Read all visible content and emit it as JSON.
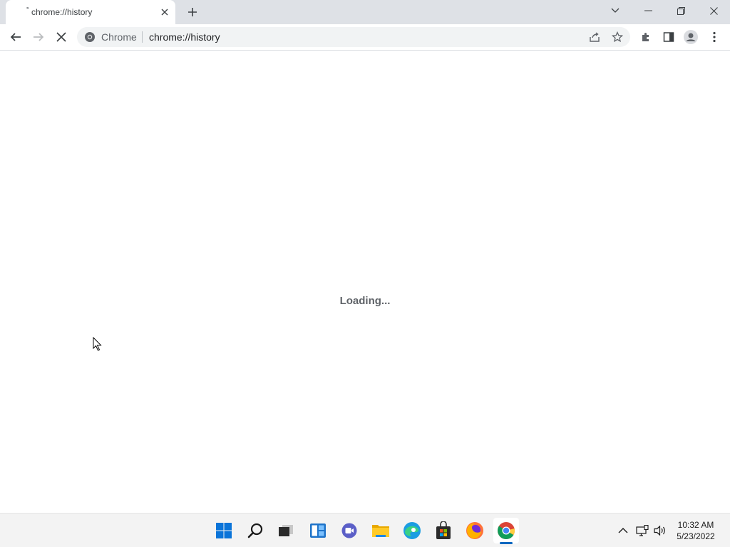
{
  "browser": {
    "tab": {
      "title": "chrome://history",
      "icon": "loading-spinner-icon",
      "close_icon": "close-icon"
    },
    "new_tab_icon": "plus-icon",
    "window_controls": [
      "chevron-down-icon",
      "minimize-icon",
      "restore-icon",
      "close-icon"
    ],
    "nav": {
      "back_icon": "arrow-left-icon",
      "forward_icon": "arrow-right-icon",
      "stop_icon": "stop-loading-icon"
    },
    "omnibox": {
      "site_chip": "Chrome",
      "url": "chrome://history",
      "site_icon": "chrome-icon",
      "share_icon": "share-icon",
      "bookmark_icon": "star-icon"
    },
    "toolbar_right": [
      "extensions-icon",
      "side-panel-icon",
      "profile-icon",
      "more-vertical-icon"
    ]
  },
  "content": {
    "loading_text": "Loading..."
  },
  "taskbar": {
    "apps": [
      "windows-start-icon",
      "search-icon",
      "task-view-icon",
      "widgets-icon",
      "teams-chat-icon",
      "file-explorer-icon",
      "edge-icon",
      "store-icon",
      "firefox-icon",
      "chrome-icon"
    ],
    "active_app": "chrome-icon",
    "tray": [
      "chevron-up-icon",
      "network-icon",
      "volume-icon"
    ],
    "clock": {
      "time": "10:32 AM",
      "date": "5/23/2022"
    }
  },
  "colors": {
    "tabstrip_bg": "#dee1e6",
    "omnibox_bg": "#f1f3f4",
    "taskbar_bg": "#f3f3f3",
    "accent": "#0067c0"
  }
}
